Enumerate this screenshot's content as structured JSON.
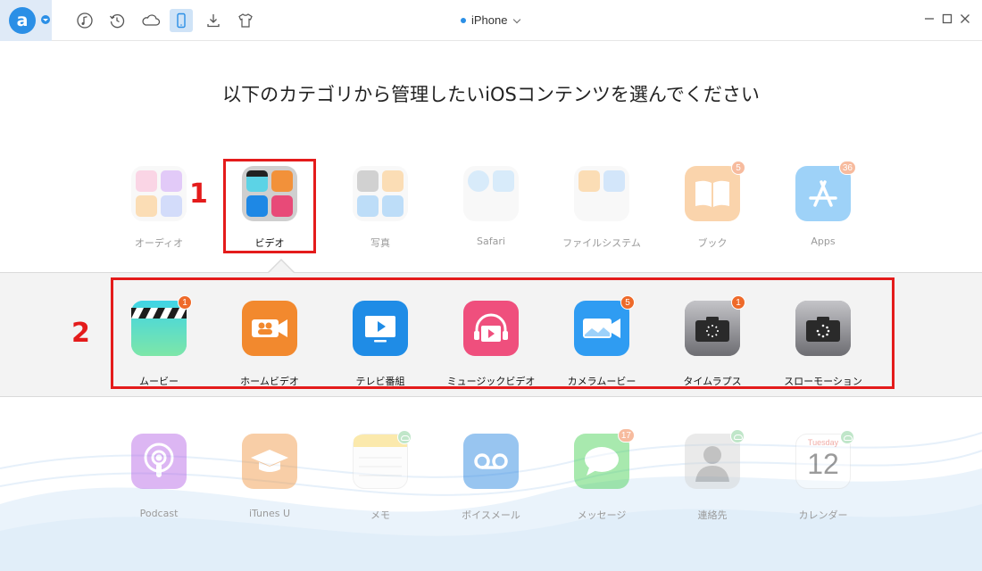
{
  "toolbar": {
    "logo_letter": "a",
    "device_name": "iPhone",
    "icons": [
      "music-icon",
      "history-icon",
      "cloud-icon",
      "phone-icon",
      "download-icon",
      "tshirt-icon"
    ],
    "active_tool": "phone-icon"
  },
  "window_controls": [
    "minimize-icon",
    "maximize-icon",
    "close-icon"
  ],
  "heading": "以下のカテゴリから管理したいiOSコンテンツを選んでください",
  "categories": [
    {
      "label": "オーディオ",
      "icon": "audio-folder-icon",
      "dimmed": true
    },
    {
      "label": "ビデオ",
      "icon": "video-folder-icon",
      "dimmed": false,
      "selected": true
    },
    {
      "label": "写真",
      "icon": "photo-folder-icon",
      "dimmed": true
    },
    {
      "label": "Safari",
      "icon": "safari-folder-icon",
      "dimmed": true
    },
    {
      "label": "ファイルシステム",
      "icon": "filesystem-folder-icon",
      "dimmed": true
    },
    {
      "label": "ブック",
      "icon": "book-icon",
      "dimmed": true,
      "badge": "5"
    },
    {
      "label": "Apps",
      "icon": "app-store-icon",
      "dimmed": true,
      "badge": "36"
    }
  ],
  "video_items": [
    {
      "label": "ムービー",
      "icon": "movie-clapper-icon",
      "badge": "1"
    },
    {
      "label": "ホームビデオ",
      "icon": "home-video-icon"
    },
    {
      "label": "テレビ番組",
      "icon": "tv-show-icon"
    },
    {
      "label": "ミュージックビデオ",
      "icon": "music-video-icon"
    },
    {
      "label": "カメラムービー",
      "icon": "camera-movie-icon",
      "badge": "5"
    },
    {
      "label": "タイムラプス",
      "icon": "timelapse-icon",
      "badge": "1"
    },
    {
      "label": "スローモーション",
      "icon": "slow-motion-icon"
    }
  ],
  "other_categories": [
    {
      "label": "Podcast",
      "icon": "podcast-icon"
    },
    {
      "label": "iTunes U",
      "icon": "itunes-u-icon"
    },
    {
      "label": "メモ",
      "icon": "notes-icon",
      "cloud": true
    },
    {
      "label": "ボイスメール",
      "icon": "voicemail-icon"
    },
    {
      "label": "メッセージ",
      "icon": "messages-icon",
      "badge": "17"
    },
    {
      "label": "連絡先",
      "icon": "contacts-icon",
      "cloud": true
    },
    {
      "label": "カレンダー",
      "icon": "calendar-icon",
      "cloud": true,
      "day_name": "Tuesday",
      "day_number": "12"
    }
  ],
  "annotations": {
    "step1": "1",
    "step2": "2"
  },
  "colors": {
    "accent": "#2b8fe6",
    "badge": "#ee6a2a",
    "annotation": "#e41b1b"
  }
}
